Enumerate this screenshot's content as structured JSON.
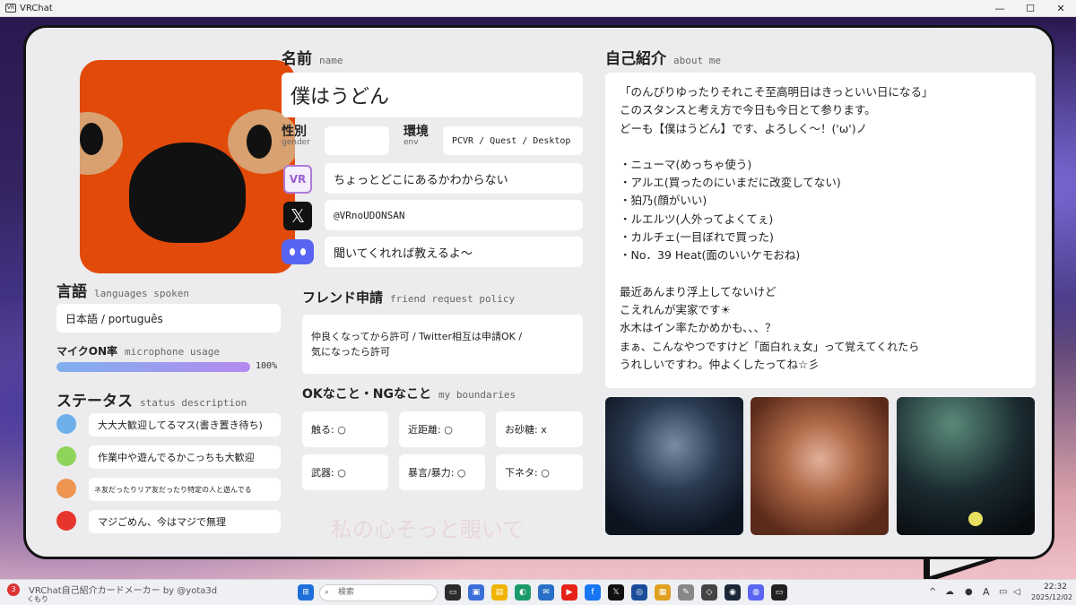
{
  "window": {
    "title": "VRChat",
    "icon_text": "VR",
    "controls": [
      "—",
      "☐",
      "✕"
    ]
  },
  "profile": {
    "name_heading": "名前",
    "name_heading_en": "name",
    "name_value": "僕はうどん",
    "gender_heading": "性別",
    "gender_heading_en": "gender",
    "gender_value": "",
    "env_heading": "環境",
    "env_heading_en": "env",
    "env_value": "PCVR / Quest / Desktop",
    "vrchat_value": "ちょっとどこにあるかわからない",
    "vrchat_icon_text": "VR",
    "x_value": "@VRnoUDONSAN",
    "discord_value": "聞いてくれれば教えるよ～",
    "friend_heading": "フレンド申請",
    "friend_heading_en": "friend request policy",
    "friend_value_line1": "仲良くなってから許可 / Twitter相互は申請OK /",
    "friend_value_line2": "気になったら許可",
    "boundaries_heading": "OKなこと・NGなこと",
    "boundaries_heading_en": "my boundaries",
    "boundaries": [
      {
        "label": "触る",
        "mark": "○"
      },
      {
        "label": "近距離",
        "mark": "○"
      },
      {
        "label": "お砂糖",
        "mark": "x"
      },
      {
        "label": "武器",
        "mark": "○"
      },
      {
        "label": "暴言/暴力",
        "mark": "○"
      },
      {
        "label": "下ネタ",
        "mark": "○"
      }
    ],
    "languages_heading": "言語",
    "languages_heading_en": "languages spoken",
    "languages_value": "日本語 / português",
    "mic_heading": "マイクON率",
    "mic_heading_en": "microphone usage",
    "mic_percent_label": "100%",
    "mic_fraction": 1.0,
    "status_heading": "ステータス",
    "status_heading_en": "status description",
    "statuses": [
      {
        "text": "大大大歓迎してるマス(書き置き待ち)",
        "color": "#6cb0ec"
      },
      {
        "text": "作業中や遊んでるかこっちも大歓迎",
        "color": "#8ed45a"
      },
      {
        "text": "ネ友だったりリア友だったり特定の人と遊んでる",
        "color": "#ee9552"
      },
      {
        "text": "マジごめん、今はマジで無理",
        "color": "#e8352c"
      }
    ],
    "about_heading": "自己紹介",
    "about_heading_en": "about me",
    "about_lines": [
      "「のんびりゆったりそれこそ至高明日はきっといい日になる」",
      "このスタンスと考え方で今日も今日とて参ります。",
      "どーも【僕はうどん】です、よろしく～！('ω')ノ",
      "",
      "・ニューマ(めっちゃ使う)",
      "・アルエ(買ったのにいまだに改変してない)",
      "・狛乃(顔がいい)",
      "・ルエルツ(人外ってよくてぇ)",
      "・カルチェ(一目ぼれで買った)",
      "・No．39 Heat(面のいいケモおね)",
      "",
      "最近あんまり浮上してないけど",
      "こえれんが実家です☀",
      "水木はイン率たかめかも、、、？",
      "まぁ、こんなやつですけど「面白れぇ女」って覚えてくれたら",
      "うれしいですわ。仲よくしたってね☆彡"
    ],
    "watermark": "私の心そっと覗いて"
  },
  "taskbar": {
    "weather_badge": "3",
    "weather_text": "くもり",
    "footer_text": "VRChat自己紹介カードメーカー by @yota3d",
    "search_placeholder": "検索",
    "time": "22:32",
    "date": "2025/12/02",
    "ime": "A"
  },
  "colors": {
    "avatar": "#e24a0a",
    "card_bg": "#ececee",
    "mic_bar_start": "#7fb0ee",
    "mic_bar_end": "#b58af0"
  }
}
